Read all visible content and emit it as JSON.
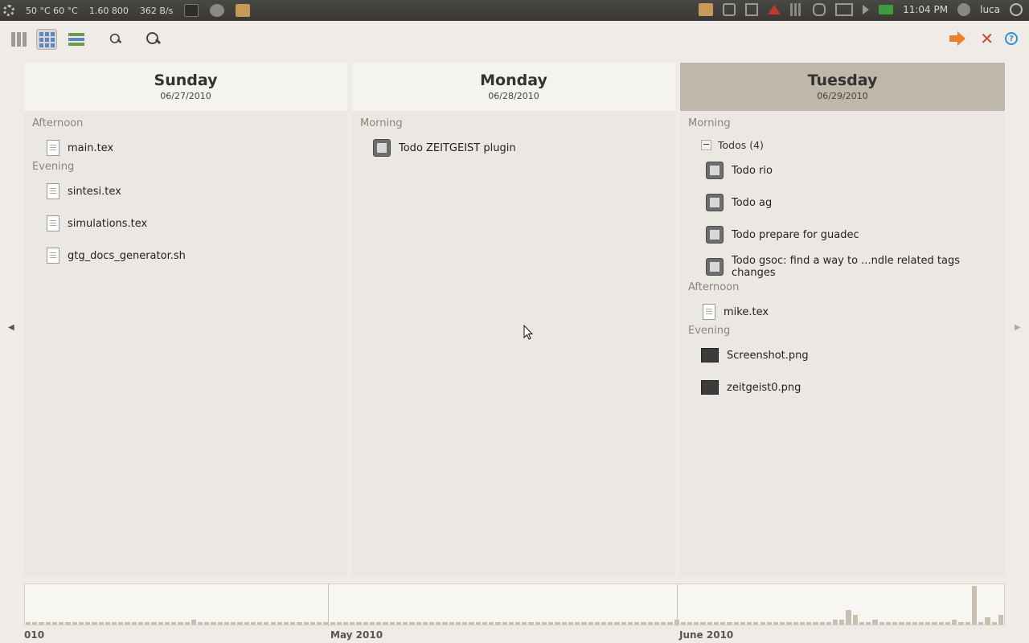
{
  "top_panel": {
    "temps": "50 °C 60 °C",
    "cpu": "1.60 800",
    "net": "362 B/s",
    "clock": "11:04 PM",
    "user": "luca"
  },
  "toolbar": {
    "icons": [
      "columns-view-icon",
      "grid-view-icon",
      "list-view-icon",
      "zoom-icon",
      "search-icon",
      "quit-icon",
      "preferences-icon",
      "help-icon"
    ]
  },
  "days": [
    {
      "name": "Sunday",
      "date": "06/27/2010",
      "sections": [
        {
          "label": "Afternoon",
          "items": [
            {
              "name": "main.tex",
              "type": "doc"
            }
          ]
        },
        {
          "label": "Evening",
          "items": [
            {
              "name": "sintesi.tex",
              "type": "doc"
            },
            {
              "name": "simulations.tex",
              "type": "doc"
            },
            {
              "name": "gtg_docs_generator.sh",
              "type": "doc"
            }
          ]
        }
      ]
    },
    {
      "name": "Monday",
      "date": "06/28/2010",
      "sections": [
        {
          "label": "Morning",
          "items": [
            {
              "name": "Todo ZEITGEIST plugin",
              "type": "todo"
            }
          ]
        }
      ]
    },
    {
      "name": "Tuesday",
      "date": "06/29/2010",
      "sections": [
        {
          "label": "Morning",
          "group": "Todos (4)",
          "items": [
            {
              "name": "Todo rio",
              "type": "todo"
            },
            {
              "name": "Todo ag",
              "type": "todo"
            },
            {
              "name": "Todo prepare for guadec",
              "type": "todo"
            },
            {
              "name": "Todo gsoc: find a way to ...ndle related tags changes",
              "type": "todo"
            }
          ]
        },
        {
          "label": "Afternoon",
          "items": [
            {
              "name": "mike.tex",
              "type": "doc"
            }
          ]
        },
        {
          "label": "Evening",
          "items": [
            {
              "name": "Screenshot.png",
              "type": "img"
            },
            {
              "name": "zeitgeist0.png",
              "type": "img"
            }
          ]
        }
      ]
    }
  ],
  "nav": {
    "prev": "◀",
    "next": "▶"
  },
  "histogram": {
    "labels": [
      "010",
      "May 2010",
      "June 2010"
    ],
    "values": [
      1,
      1,
      1,
      1,
      1,
      1,
      1,
      1,
      1,
      1,
      1,
      1,
      1,
      1,
      1,
      1,
      1,
      1,
      1,
      1,
      1,
      1,
      1,
      1,
      1,
      2,
      1,
      1,
      1,
      1,
      1,
      1,
      1,
      1,
      1,
      1,
      1,
      1,
      1,
      1,
      1,
      1,
      1,
      1,
      1,
      1,
      1,
      1,
      1,
      1,
      1,
      1,
      1,
      1,
      1,
      1,
      1,
      1,
      1,
      1,
      1,
      1,
      1,
      1,
      1,
      1,
      1,
      1,
      1,
      1,
      1,
      1,
      1,
      1,
      1,
      1,
      1,
      1,
      1,
      1,
      1,
      1,
      1,
      1,
      1,
      1,
      1,
      1,
      1,
      1,
      1,
      1,
      1,
      1,
      1,
      1,
      1,
      1,
      2,
      1,
      1,
      1,
      1,
      1,
      1,
      1,
      1,
      1,
      1,
      1,
      1,
      1,
      1,
      1,
      1,
      1,
      1,
      1,
      1,
      1,
      1,
      1,
      2,
      2,
      6,
      4,
      1,
      1,
      2,
      1,
      1,
      1,
      1,
      1,
      1,
      1,
      1,
      1,
      1,
      1,
      2,
      1,
      1,
      16,
      1,
      3,
      1,
      4
    ]
  }
}
